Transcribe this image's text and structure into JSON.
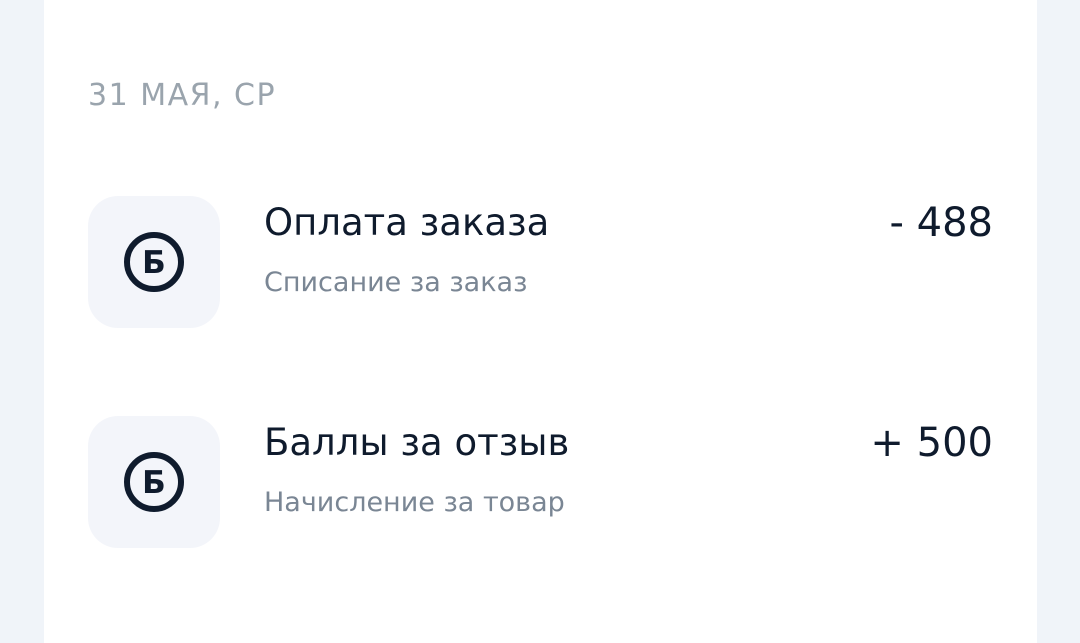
{
  "date_header": "31 МАЯ, СР",
  "icon": {
    "name": "bonus-coin-icon",
    "letter": "Б",
    "color": "#0f1b2d"
  },
  "transactions": [
    {
      "title": "Оплата заказа",
      "subtitle": "Списание за заказ",
      "amount": "- 488"
    },
    {
      "title": "Баллы за отзыв",
      "subtitle": "Начисление за товар",
      "amount": "+ 500"
    }
  ],
  "colors": {
    "page_background": "#f0f4f9",
    "card_background": "#ffffff",
    "icon_tile_background": "#f3f5fa",
    "primary_text": "#0f1b2d",
    "secondary_text": "#7a8694",
    "date_text": "#9aa4ad"
  }
}
